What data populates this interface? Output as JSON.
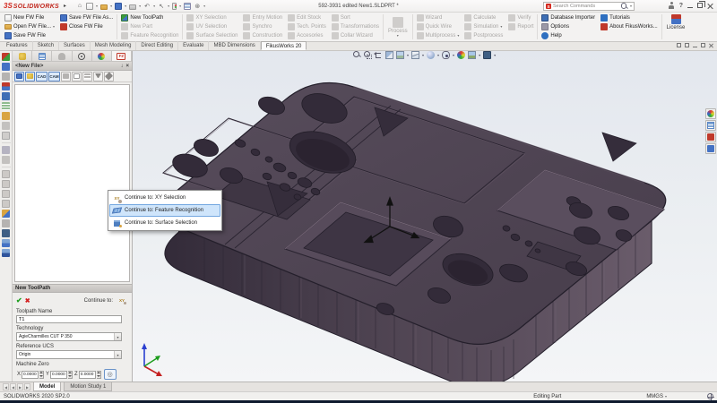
{
  "window": {
    "logo_mark": "3S",
    "brand": "SOLIDWORKS",
    "title": "592-3931 edited New1.SLDPRT *",
    "search_placeholder": "Search Commands"
  },
  "icons": {
    "flyout": "▸",
    "home": "⌂",
    "undo": "↶",
    "select": "↖",
    "gear": "⊛",
    "pin": "↓",
    "close": "×",
    "caret": "▾",
    "check": "✔",
    "cross": "✖",
    "xy": "XY",
    "target": "◎",
    "tab_prev": "◀",
    "tab_next": "▶",
    "question": "?"
  },
  "ribbon": {
    "groups": [
      {
        "items": [
          {
            "label": "New FW File",
            "enabled": true
          },
          {
            "label": "Open FW File...",
            "enabled": true
          },
          {
            "label": "Save FW File",
            "enabled": true
          }
        ]
      },
      {
        "items": [
          {
            "label": "Save FW File As...",
            "enabled": true
          },
          {
            "label": "Close FW File",
            "enabled": true
          }
        ]
      },
      {
        "items": [
          {
            "label": "New ToolPath",
            "enabled": true
          },
          {
            "label": "New Part",
            "enabled": false
          },
          {
            "label": "Feature Recognition",
            "enabled": false
          }
        ]
      },
      {
        "items": [
          {
            "label": "XY Selection",
            "enabled": false
          },
          {
            "label": "UV Selection",
            "enabled": false
          },
          {
            "label": "Surface Selection",
            "enabled": false
          }
        ]
      },
      {
        "items": [
          {
            "label": "Entry Motion",
            "enabled": false
          },
          {
            "label": "Synchro",
            "enabled": false
          },
          {
            "label": "Construction",
            "enabled": false
          }
        ]
      },
      {
        "items": [
          {
            "label": "Edit Stock",
            "enabled": false
          },
          {
            "label": "Tech. Points",
            "enabled": false
          },
          {
            "label": "Accesories",
            "enabled": false
          }
        ]
      },
      {
        "items": [
          {
            "label": "Sort",
            "enabled": false
          },
          {
            "label": "Transformations",
            "enabled": false
          },
          {
            "label": "Collar Wizard",
            "enabled": false
          }
        ]
      },
      {
        "items": [
          {
            "label": "Process",
            "enabled": false
          }
        ]
      },
      {
        "items": [
          {
            "label": "Wizard",
            "enabled": false
          },
          {
            "label": "Quick Wire",
            "enabled": false
          },
          {
            "label": "Multiprocess",
            "enabled": false
          }
        ]
      },
      {
        "items": [
          {
            "label": "Calculate",
            "enabled": false
          },
          {
            "label": "Simulation",
            "enabled": false
          },
          {
            "label": "Postprocess",
            "enabled": false
          }
        ]
      },
      {
        "items": [
          {
            "label": "Verify",
            "enabled": false
          },
          {
            "label": "Report",
            "enabled": false
          }
        ]
      },
      {
        "items": [
          {
            "label": "Database Importer",
            "enabled": true
          },
          {
            "label": "Options",
            "enabled": true
          },
          {
            "label": "Help",
            "enabled": true
          }
        ]
      },
      {
        "items": [
          {
            "label": "Tutorials",
            "enabled": true
          },
          {
            "label": "About FikusWorks...",
            "enabled": true
          }
        ]
      },
      {
        "items": [
          {
            "label": "License",
            "enabled": true
          }
        ]
      }
    ]
  },
  "tabs": {
    "items": [
      {
        "label": "Features"
      },
      {
        "label": "Sketch"
      },
      {
        "label": "Surfaces"
      },
      {
        "label": "Mesh Modeling"
      },
      {
        "label": "Direct Editing"
      },
      {
        "label": "Evaluate"
      },
      {
        "label": "MBD Dimensions"
      },
      {
        "label": "FikusWorks 20",
        "active": true
      }
    ]
  },
  "panel": {
    "header": "<New File>",
    "fz": "FZ",
    "cad": "CAD",
    "cam": "CAM",
    "toolpath": {
      "header": "New ToolPath",
      "continue_label": "Continue to:",
      "name_label": "Toolpath Name",
      "name_value": "T1",
      "technology_label": "Technology",
      "technology_value": "AgieCharmilles CUT P 350",
      "ucs_label": "Reference UCS",
      "ucs_value": "Origin",
      "zero_label": "Machine Zero",
      "axes": [
        {
          "axis": "X",
          "value": "0.0000"
        },
        {
          "axis": "Y",
          "value": "0.0000"
        },
        {
          "axis": "Z",
          "value": "0.0000"
        }
      ]
    }
  },
  "menu": {
    "items": [
      {
        "label": "Continue to: XY Selection"
      },
      {
        "label": "Continue to: Feature Recognition",
        "selected": true
      },
      {
        "label": "Continue to: Surface Selection"
      }
    ]
  },
  "bottom": {
    "tabs": [
      {
        "label": "Model",
        "active": true
      },
      {
        "label": "Motion Study 1"
      }
    ],
    "status_left": "SOLIDWORKS 2020 SP2.0",
    "editing": "Editing Part",
    "units": "MMGS"
  },
  "colors": {
    "selection_highlight": "#cfe5fb",
    "model_face": "#4a3f4d",
    "model_wall_dark": "#342c3a",
    "model_wall_light": "#6a5c6b",
    "viewport_top": "#e3e7ee",
    "viewport_bottom": "#f4f5f7"
  }
}
